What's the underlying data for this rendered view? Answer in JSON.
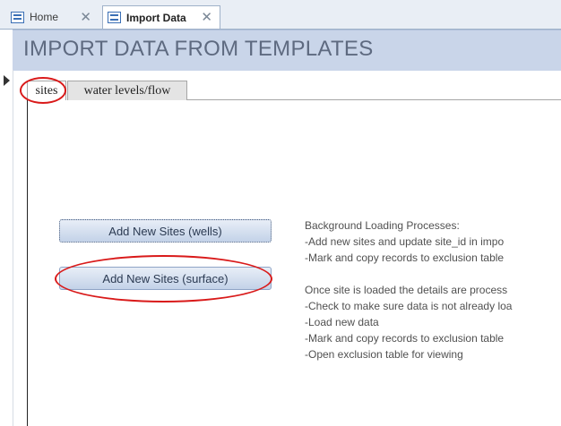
{
  "tabs": {
    "home": "Home",
    "import": "Import Data"
  },
  "header": {
    "title": "IMPORT DATA FROM TEMPLATES"
  },
  "form_tabs": {
    "sites": "sites",
    "water": "water levels/flow"
  },
  "buttons": {
    "wells": "Add New Sites (wells)",
    "surface": "Add New Sites (surface)"
  },
  "notes": {
    "heading": "Background Loading Processes:",
    "line1": "-Add new sites and update site_id in impo",
    "line2": "-Mark and copy records to exclusion table",
    "line3": "Once site is loaded the details are process",
    "line4": "-Check to make sure data is not already loa",
    "line5": "-Load new data",
    "line6": "-Mark and copy records to exclusion table",
    "line7": "-Open exclusion table for viewing"
  },
  "colors": {
    "header_bg": "#c9d5e9",
    "highlight": "#d91a1a",
    "button_border": "#8ea4c6"
  }
}
